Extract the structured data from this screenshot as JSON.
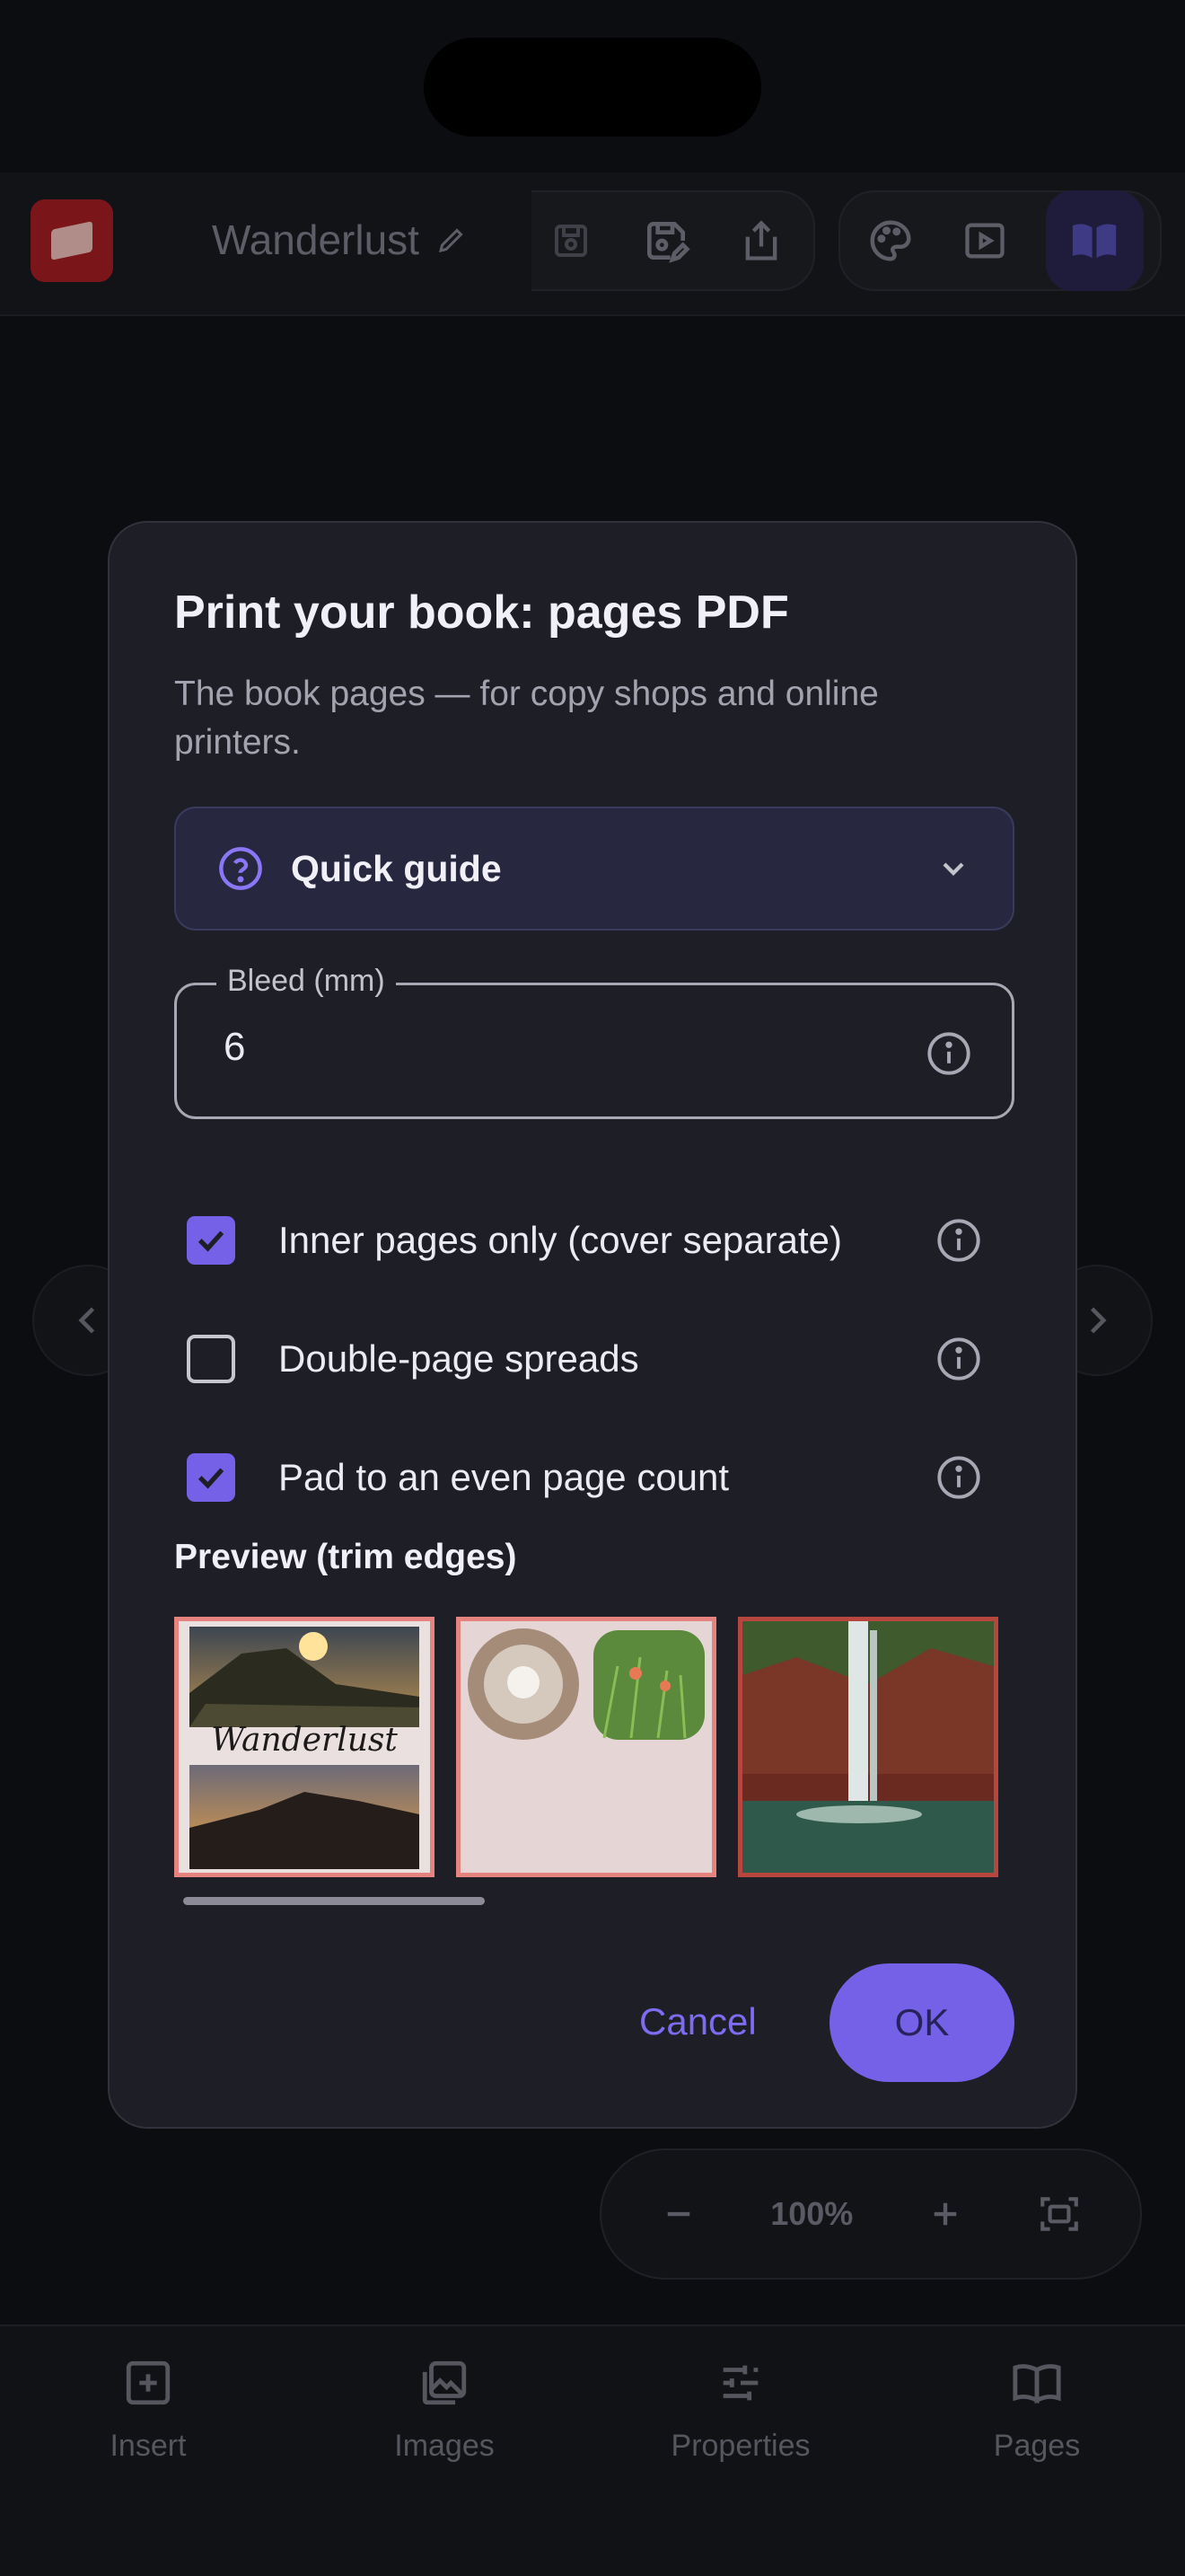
{
  "app": {
    "book_title": "Wanderlust",
    "zoom_level": "100%"
  },
  "bottom_nav": {
    "items": [
      {
        "label": "Insert",
        "icon": "plus-square-icon"
      },
      {
        "label": "Images",
        "icon": "images-icon"
      },
      {
        "label": "Properties",
        "icon": "sliders-icon"
      },
      {
        "label": "Pages",
        "icon": "book-open-icon"
      }
    ]
  },
  "dialog": {
    "title": "Print your book: pages PDF",
    "subtitle": "The book pages — for copy shops and online printers.",
    "guide_label": "Quick guide",
    "bleed": {
      "label": "Bleed (mm)",
      "value": "6"
    },
    "options": [
      {
        "label": "Inner pages only (cover separate)",
        "checked": true
      },
      {
        "label": "Double-page spreads",
        "checked": false
      },
      {
        "label": "Pad to an even page count",
        "checked": true
      }
    ],
    "preview_title": "Preview (trim edges)",
    "preview_thumb_text": "Wanderlust",
    "cancel_label": "Cancel",
    "ok_label": "OK"
  },
  "colors": {
    "accent": "#7461e8",
    "dialog_bg": "#1d1e26",
    "trim_edge": "#e7837f"
  }
}
